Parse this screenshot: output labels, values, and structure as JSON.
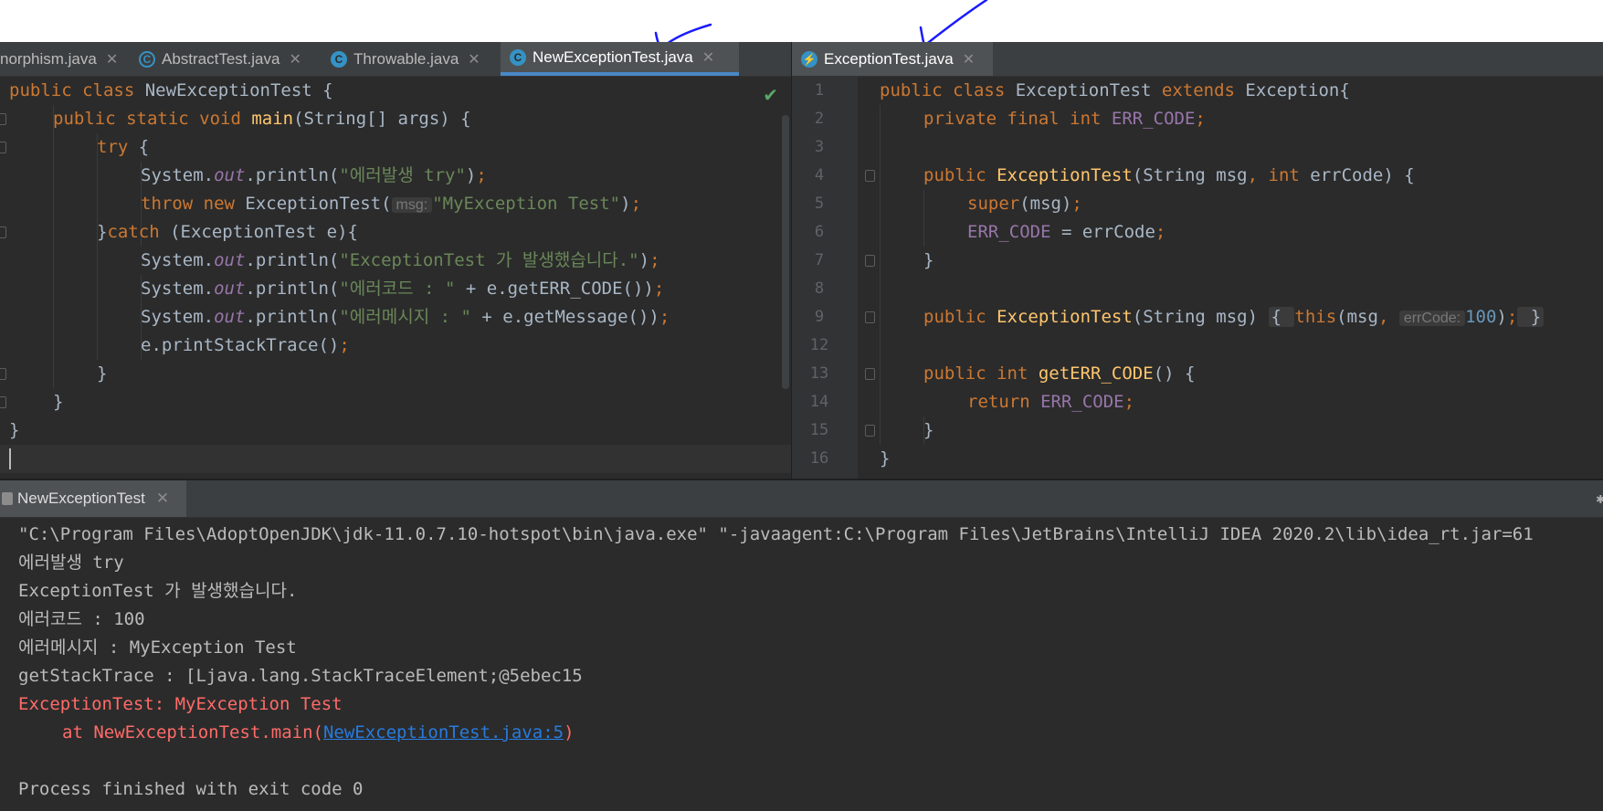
{
  "left_editor": {
    "tabs": [
      {
        "label": "norphism.java",
        "icon": "java-class-icon"
      },
      {
        "label": "AbstractTest.java",
        "icon": "abstract-class-icon"
      },
      {
        "label": "Throwable.java",
        "icon": "locked-class-icon"
      },
      {
        "label": "NewExceptionTest.java",
        "icon": "runnable-class-icon",
        "active": true
      }
    ],
    "lines": {
      "l1a": "public class ",
      "l1b": "NewExceptionTest {",
      "l2a": "public static void ",
      "l2b": "main",
      "l2c": "(String[] args) {",
      "l3a": "try",
      "l3b": " {",
      "l4a": "System.",
      "l4b": "out",
      "l4c": ".println(",
      "l4d": "\"에러발생 try\"",
      "l4e": ")",
      "l4f": ";",
      "l5a": "throw new ",
      "l5b": "ExceptionTest(",
      "l5hint": "msg:",
      "l5c": "\"MyException Test\"",
      "l5d": ")",
      "l5e": ";",
      "l6a": "}",
      "l6b": "catch ",
      "l6c": "(ExceptionTest e){",
      "l7a": "System.",
      "l7b": "out",
      "l7c": ".println(",
      "l7d": "\"ExceptionTest 가 발생했습니다.\"",
      "l7e": ")",
      "l7f": ";",
      "l8a": "System.",
      "l8b": "out",
      "l8c": ".println(",
      "l8d": "\"에러코드 : \"",
      "l8e": " + e.getERR_CODE())",
      "l8f": ";",
      "l9a": "System.",
      "l9b": "out",
      "l9c": ".println(",
      "l9d": "\"에러메시지 : \"",
      "l9e": " + e.getMessage())",
      "l9f": ";",
      "l10a": "e.printStackTrace()",
      "l10b": ";",
      "l11": "}",
      "l12": "}",
      "l13": "}"
    }
  },
  "right_editor": {
    "tab": {
      "label": "ExceptionTest.java",
      "icon": "exception-class-icon"
    },
    "line_numbers": [
      "1",
      "2",
      "3",
      "4",
      "5",
      "6",
      "7",
      "8",
      "9",
      "12",
      "13",
      "14",
      "15",
      "16"
    ],
    "lines": {
      "r1a": "public class ",
      "r1b": "ExceptionTest ",
      "r1c": "extends ",
      "r1d": "Exception{",
      "r2a": "private final int ",
      "r2b": "ERR_CODE",
      "r2c": ";",
      "r4a": "public ",
      "r4b": "ExceptionTest",
      "r4c": "(String msg",
      "r4d": ", ",
      "r4e": "int ",
      "r4f": "errCode) {",
      "r5a": "super",
      "r5b": "(msg)",
      "r5c": ";",
      "r6a": "ERR_CODE",
      "r6b": " = errCode",
      "r6c": ";",
      "r7": "}",
      "r9a": "public ",
      "r9b": "ExceptionTest",
      "r9c": "(String msg) ",
      "r9d": "{ ",
      "r9e": "this",
      "r9f": "(msg",
      "r9g": ", ",
      "r9hint": "errCode:",
      "r9h": "100",
      "r9i": ")",
      "r9j": ";",
      "r9k": " }",
      "r13a": "public int ",
      "r13b": "getERR_CODE",
      "r13c": "() {",
      "r14a": "return ",
      "r14b": "ERR_CODE",
      "r14c": ";",
      "r15": "}",
      "r16": "}"
    }
  },
  "run_panel": {
    "tab_label": "NewExceptionTest",
    "output": [
      "\"C:\\Program Files\\AdoptOpenJDK\\jdk-11.0.7.10-hotspot\\bin\\java.exe\" \"-javaagent:C:\\Program Files\\JetBrains\\IntelliJ IDEA 2020.2\\lib\\idea_rt.jar=61",
      "에러발생 try",
      "ExceptionTest 가 발생했습니다.",
      "에러코드 : 100",
      "에러메시지 : MyException Test",
      "getStackTrace : [Ljava.lang.StackTraceElement;@5ebec15",
      "ExceptionTest: MyException Test"
    ],
    "trace_prefix": "\tat NewExceptionTest.main(",
    "trace_link": "NewExceptionTest.java:5",
    "trace_suffix": ")",
    "exit_message": "Process finished with exit code 0"
  },
  "colors": {
    "editor_bg": "#2b2b2b",
    "keyword": "#cc7832",
    "string": "#6a8759",
    "field": "#9876aa",
    "method": "#ffc66d",
    "number": "#6897bb",
    "error_text": "#ff6b68",
    "link": "#287bde",
    "tab_underline": "#4a88c7",
    "annotation_pen": "#1a1aff"
  }
}
